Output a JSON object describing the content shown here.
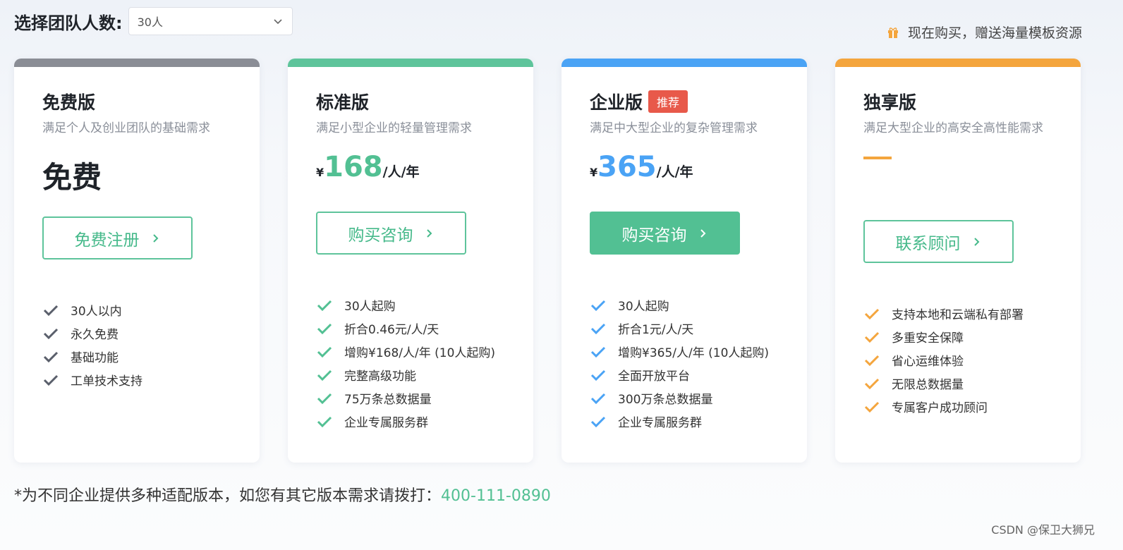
{
  "header": {
    "team_label": "选择团队人数:",
    "team_select_value": "30人",
    "promo_text": "现在购买，赠送海量模板资源"
  },
  "colors": {
    "free": "#8a8d95",
    "standard": "#5ec49b",
    "enterprise": "#4aa3f5",
    "exclusive": "#f4a53d",
    "button_green": "#52c093",
    "badge_red": "#e8594a"
  },
  "plans": [
    {
      "name": "免费版",
      "desc": "满足个人及创业团队的基础需求",
      "price_text": "免费",
      "button": "免费注册",
      "features": [
        "30人以内",
        "永久免费",
        "基础功能",
        "工单技术支持"
      ]
    },
    {
      "name": "标准版",
      "desc": "满足小型企业的轻量管理需求",
      "yen": "¥",
      "amount": "168",
      "unit": "/人/年",
      "button": "购买咨询",
      "features": [
        "30人起购",
        "折合0.46元/人/天",
        "增购¥168/人/年 (10人起购)",
        "完整高级功能",
        "75万条总数据量",
        "企业专属服务群"
      ]
    },
    {
      "name": "企业版",
      "badge": "推荐",
      "desc": "满足中大型企业的复杂管理需求",
      "yen": "¥",
      "amount": "365",
      "unit": "/人/年",
      "button": "购买咨询",
      "features": [
        "30人起购",
        "折合1元/人/天",
        "增购¥365/人/年 (10人起购)",
        "全面开放平台",
        "300万条总数据量",
        "企业专属服务群"
      ]
    },
    {
      "name": "独享版",
      "desc": "满足大型企业的高安全高性能需求",
      "button": "联系顾问",
      "features": [
        "支持本地和云端私有部署",
        "多重安全保障",
        "省心运维体验",
        "无限总数据量",
        "专属客户成功顾问"
      ]
    }
  ],
  "footer": {
    "note": "*为不同企业提供多种适配版本，如您有其它版本需求请拨打：",
    "phone": "400-111-0890",
    "watermark": "CSDN @保卫大狮兄"
  }
}
